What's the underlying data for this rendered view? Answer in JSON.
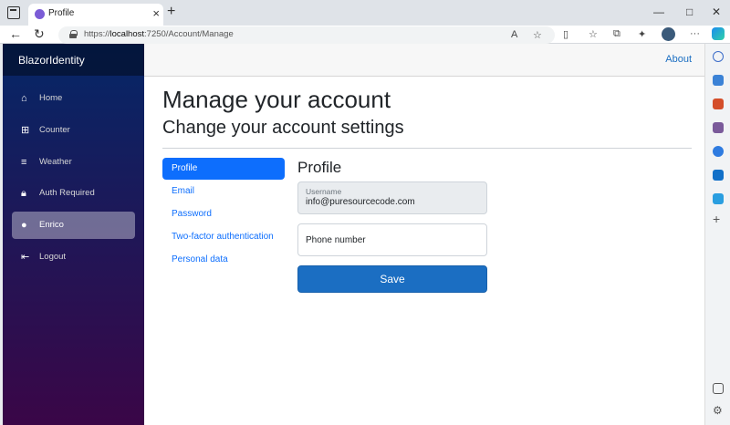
{
  "browser": {
    "tab_title": "Profile",
    "tab_close": "×",
    "new_tab": "+",
    "url_scheme": "https://",
    "url_host": "localhost",
    "url_rest": ":7250/Account/Manage",
    "minimize": "—",
    "maximize": "□",
    "close": "✕"
  },
  "sidebar": {
    "brand": "BlazorIdentity",
    "items": [
      {
        "label": "Home",
        "icon": "home-icon"
      },
      {
        "label": "Counter",
        "icon": "plus-square-icon"
      },
      {
        "label": "Weather",
        "icon": "list-icon"
      },
      {
        "label": "Auth Required",
        "icon": "lock-icon"
      },
      {
        "label": "Enrico",
        "icon": "person-icon",
        "active": true
      },
      {
        "label": "Logout",
        "icon": "logout-icon"
      }
    ]
  },
  "topbar": {
    "about": "About"
  },
  "page": {
    "title": "Manage your account",
    "subtitle": "Change your account settings"
  },
  "manage_nav": [
    {
      "label": "Profile",
      "active": true
    },
    {
      "label": "Email"
    },
    {
      "label": "Password"
    },
    {
      "label": "Two-factor authentication"
    },
    {
      "label": "Personal data"
    }
  ],
  "profile": {
    "heading": "Profile",
    "username_label": "Username",
    "username_value": "info@puresourcecode.com",
    "phone_placeholder": "Phone number",
    "save_label": "Save"
  },
  "colors": {
    "primary": "#1b6ec2",
    "active_pill": "#0d6efd",
    "sidebar_top": "#052767",
    "sidebar_bottom": "#3a0647"
  }
}
